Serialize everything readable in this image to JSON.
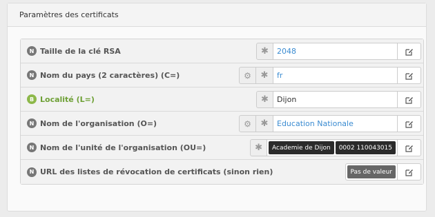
{
  "panel": {
    "title": "Paramètres des certificats"
  },
  "rows": [
    {
      "badge": "N",
      "label": "Taille de la clé RSA",
      "value": "2048"
    },
    {
      "badge": "N",
      "label": "Nom du pays (2 caractères) (C=)",
      "value": "fr"
    },
    {
      "badge": "B",
      "label": "Localité (L=)",
      "value": "Dijon"
    },
    {
      "badge": "N",
      "label": "Nom de l'organisation (O=)",
      "value": "Education Nationale"
    },
    {
      "badge": "N",
      "label": "Nom de l'unité de l'organisation (OU=)",
      "values": [
        "Academie de Dijon",
        "0002 110043015"
      ]
    },
    {
      "badge": "N",
      "label": "URL des listes de révocation de certificats (sinon rien)",
      "empty_label": "Pas de valeur"
    }
  ],
  "colors": {
    "normal_badge": "#777777",
    "basic_badge": "#8db84a",
    "link_value": "#3a8bd1"
  },
  "icons": {
    "required": "asterisk-icon",
    "multi": "gears-icon",
    "edit": "edit-icon"
  }
}
